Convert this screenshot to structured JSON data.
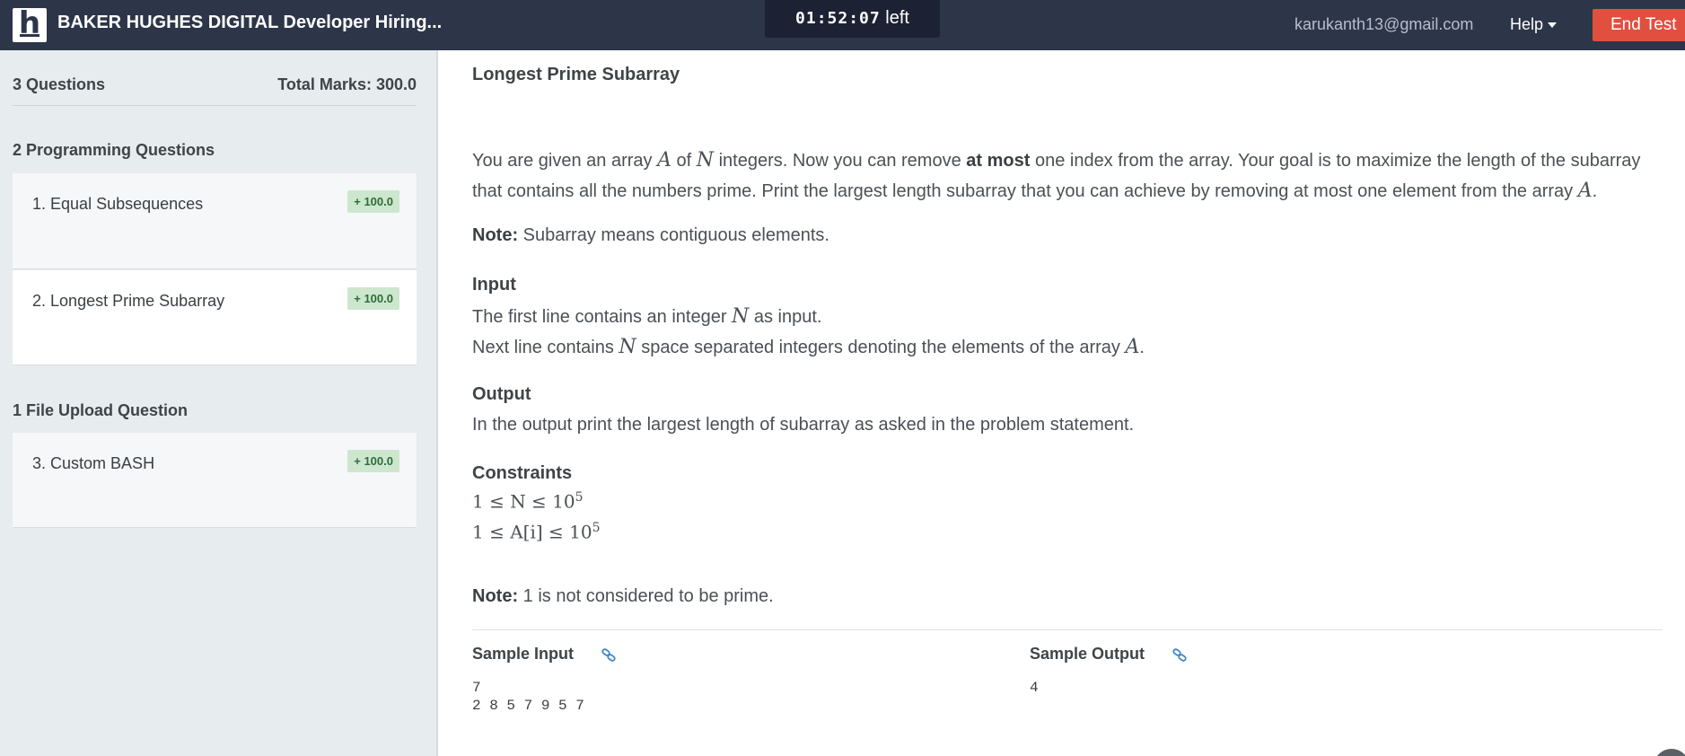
{
  "header": {
    "logo_letter": "h",
    "title": "BAKER HUGHES DIGITAL Developer Hiring...",
    "timer_value": "01:52:07",
    "timer_suffix": "left",
    "email": "karukanth13@gmail.com",
    "help_label": "Help",
    "end_test_label": "End Test"
  },
  "sidebar": {
    "question_count": "3 Questions",
    "total_marks": "Total Marks: 300.0",
    "programming_section": "2 Programming Questions",
    "file_upload_section": "1 File Upload Question",
    "questions": [
      {
        "number": "1.",
        "title": "Equal Subsequences",
        "marks": "+ 100.0"
      },
      {
        "number": "2.",
        "title": "Longest Prime Subarray",
        "marks": "+ 100.0"
      },
      {
        "number": "3.",
        "title": "Custom BASH",
        "marks": "+ 100.0"
      }
    ]
  },
  "problem": {
    "title": "Longest Prime Subarray",
    "intro_1": "You are given an array ",
    "var_A": "A",
    "of": " of ",
    "var_N": "N",
    "intro_2": " integers. Now you can remove ",
    "at_most": "at most",
    "intro_3": " one index from the array. Your goal is to maximize the length of the subarray that contains all the numbers prime. Print the largest length subarray that you can achieve by removing at most one element from the array ",
    "period": ".",
    "note_label": "Note:",
    "note_1": " Subarray means contiguous elements.",
    "input_heading": "Input",
    "input_line1_a": "The first line contains an integer ",
    "input_line1_b": " as input.",
    "input_line2_a": "Next line contains ",
    "input_line2_b": " space separated integers denoting the elements of the array ",
    "output_heading": "Output",
    "output_text": "In the output print the largest length of subarray as asked in the problem statement.",
    "constraints_heading": "Constraints",
    "constraint_1": "1 ≤ N ≤ 10",
    "constraint_1_exp": "5",
    "constraint_2": "1 ≤ A[i] ≤ 10",
    "constraint_2_exp": "5",
    "note_2": " 1 is not considered to be prime.",
    "sample_input_label": "Sample Input",
    "sample_output_label": "Sample Output",
    "sample_input": "7\n2 8 5 7 9 5 7",
    "sample_output": "4"
  },
  "colors": {
    "header_bg": "#2d3549",
    "end_test_bg": "#e14f3f",
    "sidebar_bg": "#e7ecef",
    "badge_bg": "#cde7cf",
    "link_icon": "#3c87c8"
  }
}
